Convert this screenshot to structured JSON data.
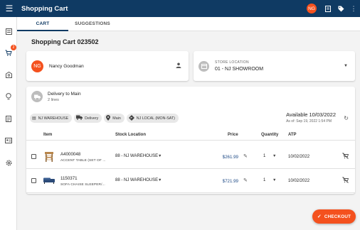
{
  "app": {
    "title": "Shopping Cart",
    "user_initials": "NG"
  },
  "rail": {
    "cart_badge": "2"
  },
  "tabs": [
    {
      "label": "CART",
      "active": true
    },
    {
      "label": "SUGGESTIONS",
      "active": false
    }
  ],
  "cart": {
    "heading": "Shopping Cart 023502"
  },
  "customer": {
    "initials": "NG",
    "name": "Nancy Goodman"
  },
  "store": {
    "label": "STORE LOCATION",
    "value": "01 - NJ SHOWROOM"
  },
  "delivery": {
    "title": "Delivery to Main",
    "subtitle": "2 lines",
    "chips": [
      {
        "icon": "warehouse-icon",
        "label": "NJ WAREHOUSE"
      },
      {
        "icon": "truck-icon",
        "label": "Delivery"
      },
      {
        "icon": "location-pin-icon",
        "label": "Main"
      },
      {
        "icon": "direction-icon",
        "label": "NJ LOCAL (MON-SAT)"
      }
    ],
    "available": "Available 10/03/2022",
    "as_of": "As of: Sep 19, 2022 1:54 PM"
  },
  "table": {
    "headers": {
      "item": "Item",
      "stock": "Stock Location",
      "price": "Price",
      "quantity": "Quantity",
      "atp": "ATP"
    },
    "rows": [
      {
        "sku": "A4000048",
        "desc": "ACCENT TABLE (SET OF ...",
        "location": "88 - NJ WAREHOUSE",
        "price": "$261.99",
        "qty": "1",
        "atp": "10/02/2022"
      },
      {
        "sku": "1150371",
        "desc": "SOFA CHAISE SLEEPER/...",
        "location": "88 - NJ WAREHOUSE",
        "price": "$721.99",
        "qty": "1",
        "atp": "10/02/2022"
      }
    ]
  },
  "checkout": {
    "label": "CHECKOUT"
  },
  "colors": {
    "primary": "#0f3a63",
    "accent": "#f4511e",
    "price": "#1e4a86"
  }
}
